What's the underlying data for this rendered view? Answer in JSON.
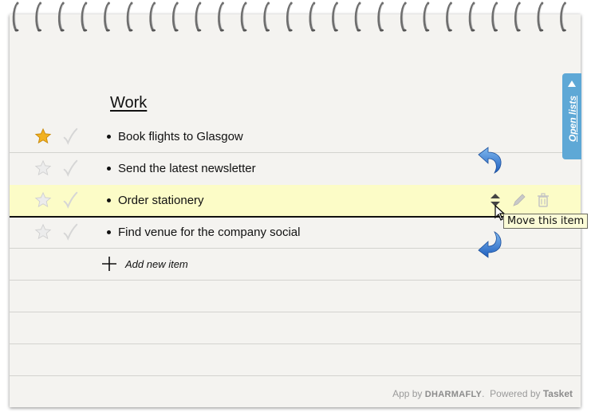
{
  "list": {
    "title": "Work",
    "items": [
      {
        "text": "Book flights to Glasgow",
        "starred": true,
        "selected": false
      },
      {
        "text": "Send the latest newsletter",
        "starred": false,
        "selected": false
      },
      {
        "text": "Order stationery",
        "starred": false,
        "selected": true
      },
      {
        "text": "Find venue for the company social",
        "starred": false,
        "selected": false
      }
    ],
    "add_label": "Add new item"
  },
  "sidebar": {
    "open_lists_label": "Open lists"
  },
  "tooltip": {
    "text": "Move this item"
  },
  "footer": {
    "app_by": "App by",
    "brand": "DHARMAFLY",
    "separator": ".",
    "powered_by": "Powered by",
    "product": "Tasket"
  },
  "colors": {
    "star_active": "#f2b11f",
    "star_inactive": "#d9d9d9",
    "selected_row": "#fcfcc7",
    "tab_blue": "#5ea8d6",
    "arrow_blue": "#2f7fd6"
  },
  "icons": [
    "star-icon",
    "checkmark-icon",
    "plus-icon",
    "move-icon",
    "pencil-icon",
    "trash-icon",
    "undo-arrow-icon",
    "cursor-icon"
  ]
}
